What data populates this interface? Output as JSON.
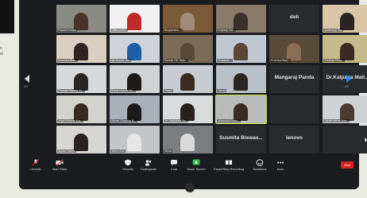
{
  "side_text": "n\ncl",
  "tiles": [
    {
      "label": "Puneet Kumar",
      "big": "",
      "video": true,
      "wall": "#8a8a84",
      "skin": "#4a3428"
    },
    {
      "label": "Office Of P...",
      "big": "",
      "video": true,
      "wall": "#f0f0f0",
      "skin": "#c22a2a"
    },
    {
      "label": "Bhupendra ...",
      "big": "",
      "video": true,
      "wall": "#7b5a3a",
      "skin": "#a08a78"
    },
    {
      "label": "Kuldeep Sa...",
      "big": "",
      "video": true,
      "wall": "#8a7a6a",
      "skin": "#3b2f2a"
    },
    {
      "label": "",
      "big": "deli",
      "video": false
    },
    {
      "label": "Jyotirmoy Roy",
      "big": "",
      "video": true,
      "wall": "#d8c6a6",
      "skin": "#2b2420"
    },
    {
      "label": "Anamika Bha...",
      "big": "",
      "video": true,
      "wall": "#d9cfc1",
      "skin": "#2e2520"
    },
    {
      "label": "Ajit Kumar Sau",
      "big": "",
      "video": true,
      "wall": "#cfd3d7",
      "skin": "#1f5fa8"
    },
    {
      "label": "Suresh Ch. Mall...",
      "big": "",
      "video": true,
      "wall": "#7c6b57",
      "skin": "#5a4a3c"
    },
    {
      "label": "Prasanta ...",
      "big": "",
      "video": true,
      "wall": "#bfc7d1",
      "skin": "#5c4636"
    },
    {
      "label": "Pramod Ranj...",
      "big": "",
      "video": true,
      "wall": "#5a4a3a",
      "skin": "#8b6d55"
    },
    {
      "label": "Soumya Ranj...",
      "big": "",
      "video": true,
      "wall": "#c6b98c",
      "skin": "#3a2a22"
    },
    {
      "label": "Bhabani Sankar M...",
      "big": "",
      "video": true,
      "wall": "#d6d9dc",
      "skin": "#2c2622"
    },
    {
      "label": "Ramit Kumar Mo...",
      "big": "",
      "video": true,
      "wall": "#d0d2d4",
      "skin": "#1e1a18"
    },
    {
      "label": "Rasmi",
      "big": "",
      "video": true,
      "wall": "#c8ccd0",
      "skin": "#3b2c22"
    },
    {
      "label": "Ashok",
      "big": "",
      "video": true,
      "wall": "#b9c0c7",
      "skin": "#2d2520"
    },
    {
      "label": "",
      "big": "Mangaraj Panda",
      "video": false
    },
    {
      "label": "",
      "big": "Dr.Kalpana Mall...",
      "video": false
    },
    {
      "label": "Jugal Kishore Pat...",
      "big": "",
      "video": true,
      "wall": "#d3d3ce",
      "skin": "#3a2a20"
    },
    {
      "label": "Subas Chandra R...",
      "big": "",
      "video": true,
      "wall": "#a9b0b8",
      "skin": "#1b1b1b"
    },
    {
      "label": "Dr. Siddharth Pa...",
      "big": "",
      "video": true,
      "wall": "#d9dbdd",
      "skin": "#27211d"
    },
    {
      "label": "Mahendra Nath...",
      "big": "",
      "video": true,
      "wall": "#b8bbb9",
      "skin": "#3b2b22"
    },
    {
      "label": "",
      "big": "",
      "video": false
    },
    {
      "label": "Jayakrushna Mah...",
      "big": "",
      "video": true,
      "wall": "#cfd2d5",
      "skin": "#4a3a30"
    },
    {
      "label": "Sujata Sahoo",
      "big": "",
      "video": true,
      "wall": "#d8d6d2",
      "skin": "#2b231f"
    },
    {
      "label": "Tech 1932",
      "big": "",
      "video": true,
      "wall": "#c3c6c9",
      "skin": "#e6e6e6"
    },
    {
      "label": "Sithal",
      "big": "",
      "video": true,
      "wall": "#7a7c80",
      "skin": "#d9d9d9"
    },
    {
      "label": "",
      "big": "Susmita Biswas...",
      "video": false
    },
    {
      "label": "",
      "big": "lenovo",
      "video": false
    },
    {
      "label": "",
      "big": "",
      "video": false
    }
  ],
  "nav": {
    "left_page": "1/2",
    "right_page": "1/2"
  },
  "toolbar": {
    "unmute": "Unmute",
    "start_video": "Start Video",
    "security": "Security",
    "participants": "Participants",
    "chat": "Chat",
    "share_screen": "Share Screen",
    "pause_recording": "Pause/Stop Recording",
    "reactions": "Reactions",
    "more": "More",
    "end": "End"
  },
  "colors": {
    "share": "#2dbf4a",
    "end": "#d22",
    "active_border": "#c7e23a"
  }
}
